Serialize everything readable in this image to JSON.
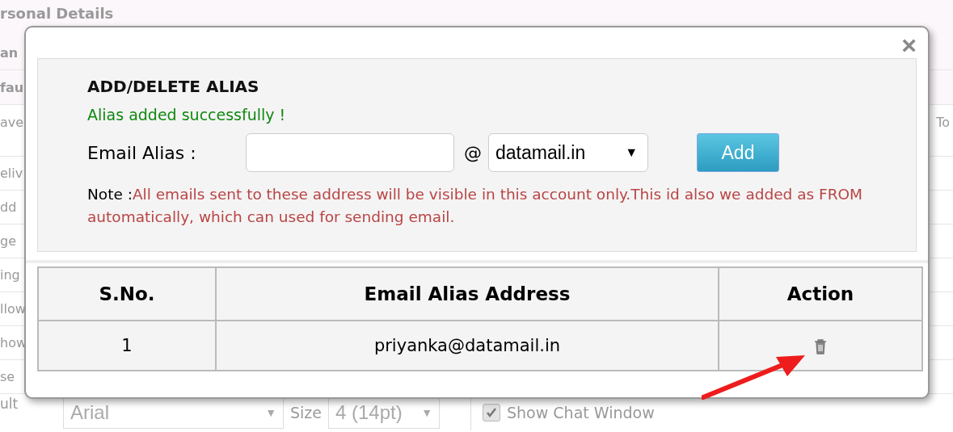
{
  "background": {
    "heading": "rsonal Details",
    "labels": [
      "an",
      "fau",
      "ave",
      "eliv",
      "dd",
      "ge",
      "ing",
      "llow",
      "how",
      "se"
    ],
    "right_label": "To",
    "bottom_label": "ult",
    "font_select": "Arial",
    "size_label": "Size",
    "size_select": "4 (14pt)",
    "caret": "▼",
    "chat": {
      "label": "Show Chat Window",
      "checked": true
    }
  },
  "dialog": {
    "close": "×",
    "title": "ADD/DELETE ALIAS",
    "message": "Alias added successfully !",
    "email_label": "Email Alias :",
    "at": "@",
    "domain": "datamail.in",
    "domain_caret": "▼",
    "add_button": "Add",
    "note_label": "Note :",
    "note_text": "All emails sent to these address will be visible in this account only.This id also we added as FROM automatically, which can used for sending email.",
    "table": {
      "columns": [
        "S.No.",
        "Email Alias Address",
        "Action"
      ],
      "rows": [
        {
          "sno": "1",
          "address": "priyanka@datamail.in"
        }
      ]
    }
  }
}
